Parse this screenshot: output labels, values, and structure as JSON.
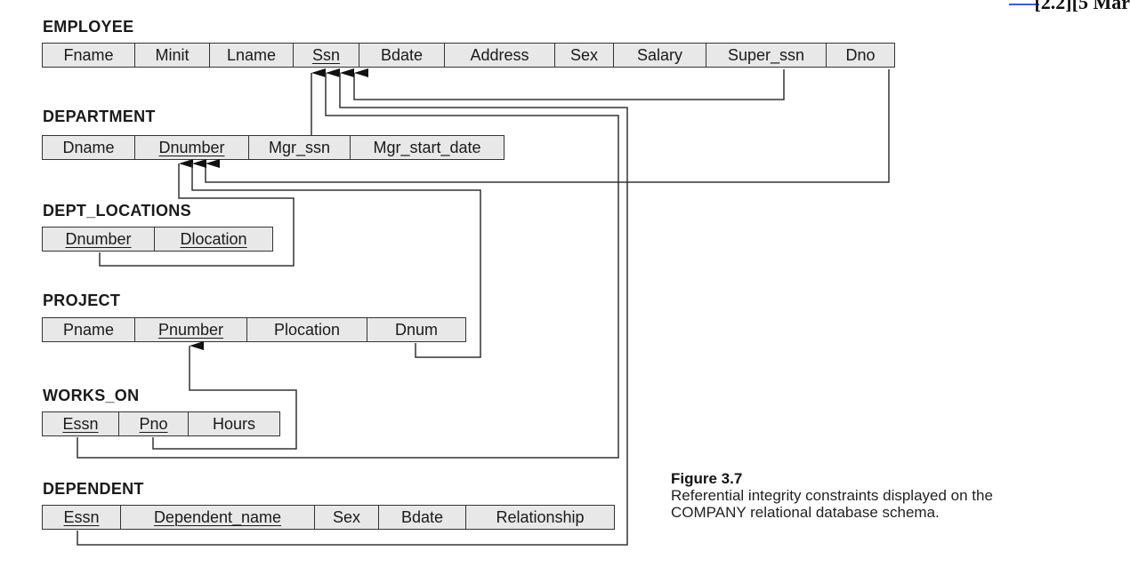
{
  "corner_text": "[2.2][5 Mar",
  "relations": [
    {
      "name": "EMPLOYEE",
      "attributes": [
        {
          "label": "Fname",
          "pk": false
        },
        {
          "label": "Minit",
          "pk": false
        },
        {
          "label": "Lname",
          "pk": false
        },
        {
          "label": "Ssn",
          "pk": true
        },
        {
          "label": "Bdate",
          "pk": false
        },
        {
          "label": "Address",
          "pk": false
        },
        {
          "label": "Sex",
          "pk": false
        },
        {
          "label": "Salary",
          "pk": false
        },
        {
          "label": "Super_ssn",
          "pk": false
        },
        {
          "label": "Dno",
          "pk": false
        }
      ]
    },
    {
      "name": "DEPARTMENT",
      "attributes": [
        {
          "label": "Dname",
          "pk": false
        },
        {
          "label": "Dnumber",
          "pk": true
        },
        {
          "label": "Mgr_ssn",
          "pk": false
        },
        {
          "label": "Mgr_start_date",
          "pk": false
        }
      ]
    },
    {
      "name": "DEPT_LOCATIONS",
      "attributes": [
        {
          "label": "Dnumber",
          "pk": true
        },
        {
          "label": "Dlocation",
          "pk": true
        }
      ]
    },
    {
      "name": "PROJECT",
      "attributes": [
        {
          "label": "Pname",
          "pk": false
        },
        {
          "label": "Pnumber",
          "pk": true
        },
        {
          "label": "Plocation",
          "pk": false
        },
        {
          "label": "Dnum",
          "pk": false
        }
      ]
    },
    {
      "name": "WORKS_ON",
      "attributes": [
        {
          "label": "Essn",
          "pk": true
        },
        {
          "label": "Pno",
          "pk": true
        },
        {
          "label": "Hours",
          "pk": false
        }
      ]
    },
    {
      "name": "DEPENDENT",
      "attributes": [
        {
          "label": "Essn",
          "pk": true
        },
        {
          "label": "Dependent_name",
          "pk": true
        },
        {
          "label": "Sex",
          "pk": false
        },
        {
          "label": "Bdate",
          "pk": false
        },
        {
          "label": "Relationship",
          "pk": false
        }
      ]
    }
  ],
  "foreign_keys": [
    {
      "from": "EMPLOYEE.Super_ssn",
      "to": "EMPLOYEE.Ssn"
    },
    {
      "from": "EMPLOYEE.Dno",
      "to": "DEPARTMENT.Dnumber"
    },
    {
      "from": "DEPARTMENT.Mgr_ssn",
      "to": "EMPLOYEE.Ssn"
    },
    {
      "from": "DEPT_LOCATIONS.Dnumber",
      "to": "DEPARTMENT.Dnumber"
    },
    {
      "from": "PROJECT.Dnum",
      "to": "DEPARTMENT.Dnumber"
    },
    {
      "from": "WORKS_ON.Essn",
      "to": "EMPLOYEE.Ssn"
    },
    {
      "from": "WORKS_ON.Pno",
      "to": "PROJECT.Pnumber"
    },
    {
      "from": "DEPENDENT.Essn",
      "to": "EMPLOYEE.Ssn"
    }
  ],
  "caption": {
    "figure": "Figure 3.7",
    "text": "Referential integrity constraints displayed on the COMPANY relational database schema."
  }
}
